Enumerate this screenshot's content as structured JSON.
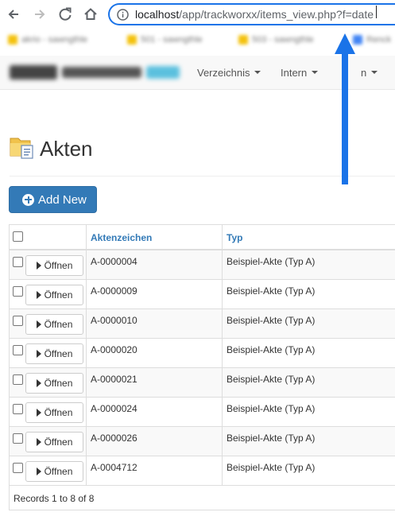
{
  "browser": {
    "url_host": "localhost",
    "url_path": "/app/trackworxx/items_view.php?f=date",
    "bookmarks": [
      {
        "label": "akrio - sawngthle",
        "color": "#f4c20d"
      },
      {
        "label": "501 - sawngthle",
        "color": "#f4c20d"
      },
      {
        "label": "503 - sawngthle",
        "color": "#f4c20d"
      },
      {
        "label": "Renck",
        "color": "#4285f4"
      }
    ]
  },
  "navbar": {
    "items": [
      "Verzeichnis",
      "Intern",
      "n"
    ]
  },
  "page": {
    "title": "Akten",
    "add_new_label": "Add New"
  },
  "table": {
    "columns": [
      "Aktenzeichen",
      "Typ"
    ],
    "open_label": "Öffnen",
    "rows": [
      {
        "aktenzeichen": "A-0000004",
        "typ": "Beispiel-Akte (Typ A)"
      },
      {
        "aktenzeichen": "A-0000009",
        "typ": "Beispiel-Akte (Typ A)"
      },
      {
        "aktenzeichen": "A-0000010",
        "typ": "Beispiel-Akte (Typ A)"
      },
      {
        "aktenzeichen": "A-0000020",
        "typ": "Beispiel-Akte (Typ A)"
      },
      {
        "aktenzeichen": "A-0000021",
        "typ": "Beispiel-Akte (Typ A)"
      },
      {
        "aktenzeichen": "A-0000024",
        "typ": "Beispiel-Akte (Typ A)"
      },
      {
        "aktenzeichen": "A-0000026",
        "typ": "Beispiel-Akte (Typ A)"
      },
      {
        "aktenzeichen": "A-0004712",
        "typ": "Beispiel-Akte (Typ A)"
      }
    ],
    "footer": "Records 1 to 8 of 8"
  },
  "colors": {
    "accent": "#337ab7",
    "arrow": "#1a73e8"
  },
  "icons": [
    "back-arrow-icon",
    "forward-arrow-icon",
    "reload-icon",
    "home-icon",
    "info-icon",
    "folder-document-icon",
    "plus-circle-icon",
    "play-icon",
    "annotation-arrow-icon"
  ]
}
